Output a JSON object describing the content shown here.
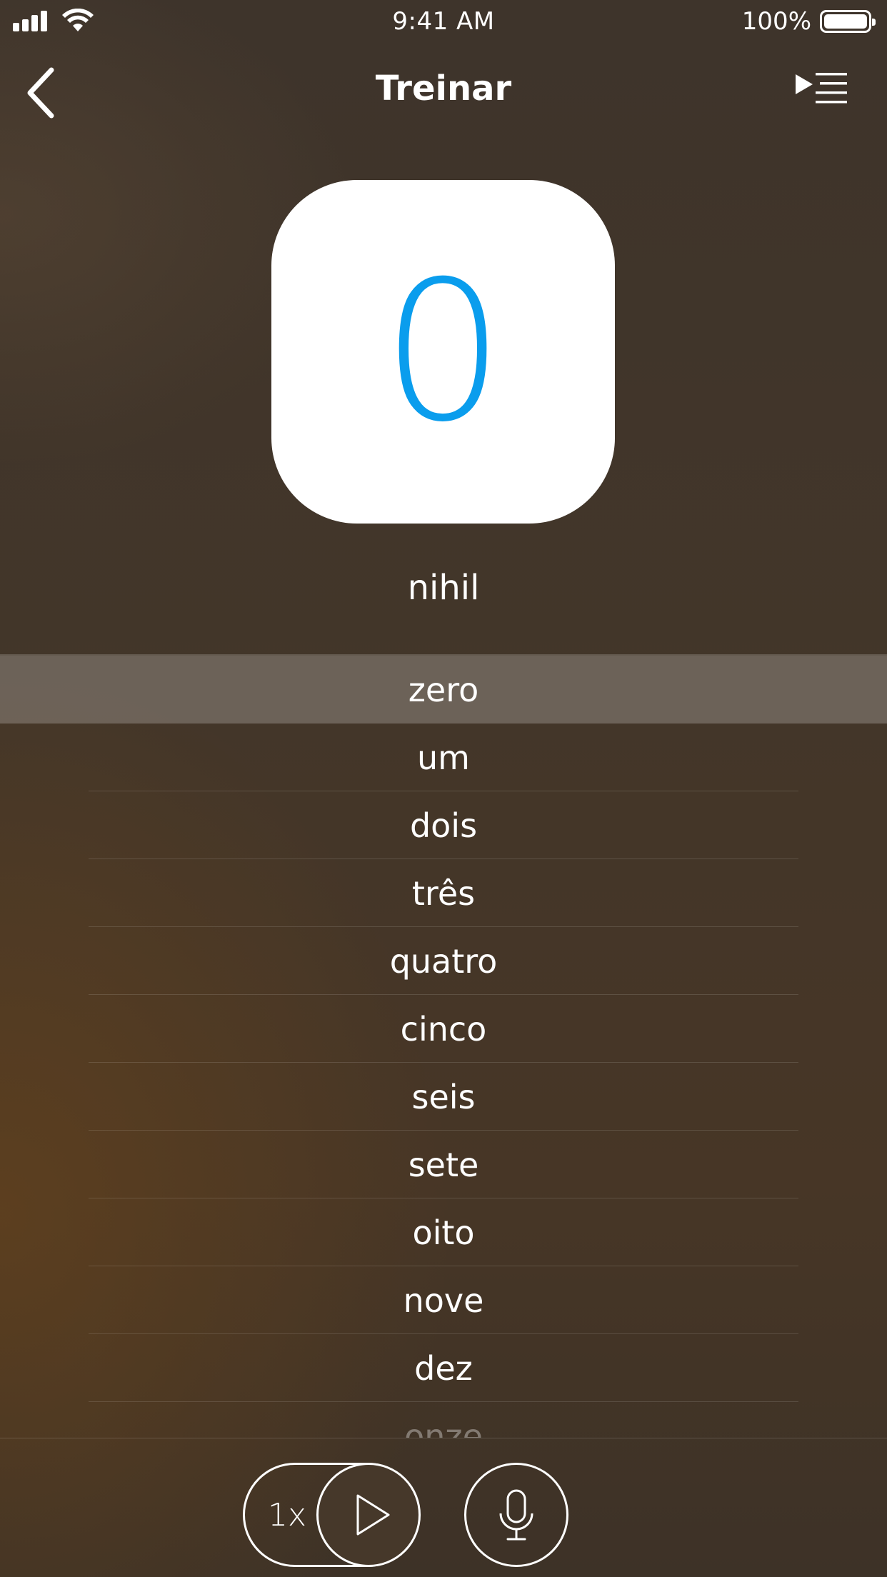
{
  "status_bar": {
    "time": "9:41 AM",
    "battery_percent": "100%",
    "battery_level": 1.0,
    "signal_icon": "signal-bars-icon",
    "wifi_icon": "wifi-icon"
  },
  "nav": {
    "title": "Treinar",
    "back_icon": "chevron-left-icon",
    "queue_icon": "play-queue-icon"
  },
  "card": {
    "digit": "0",
    "word": "nihil",
    "digit_color": "#0a9ded"
  },
  "list": {
    "items": [
      {
        "label": "zero",
        "selected": true
      },
      {
        "label": "um"
      },
      {
        "label": "dois"
      },
      {
        "label": "três"
      },
      {
        "label": "quatro"
      },
      {
        "label": "cinco"
      },
      {
        "label": "seis"
      },
      {
        "label": "sete"
      },
      {
        "label": "oito"
      },
      {
        "label": "nove"
      },
      {
        "label": "dez"
      },
      {
        "label": "onze"
      }
    ]
  },
  "controls": {
    "speed_label": "1x",
    "play_icon": "play-icon",
    "mic_icon": "microphone-icon"
  }
}
